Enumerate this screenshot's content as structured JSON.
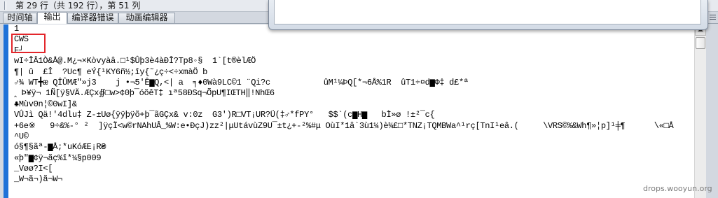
{
  "status_bar": {
    "position": "第 29 行（共 192 行），第 51 列"
  },
  "tabs": [
    {
      "label": "时间轴",
      "active": false
    },
    {
      "label": "输出",
      "active": true
    },
    {
      "label": "编译器错误",
      "active": false
    },
    {
      "label": "动画编辑器",
      "active": false
    }
  ],
  "output": {
    "lines": [
      "1",
      "CWS",
      "F┘",
      "wI÷ÎÂ1Ò&Å@.M¿¬×Kòvyàâ.□¹$Ûþ3è4àÐÎ?Tp8◦§  1`[t®èlÆÖ",
      "¶| û  £Î  ?Uc¶ eÝ{¹KY6ñ½;îy{˜¿ç÷<÷xmàÖ b",
      "♂¾ WT╋æ QÎÛMÆ\"»j3    j •¬5'Ê▆Q,<| a  ╕♦0Wà9LC©1 ¨Qi?c           ûM¹¼ÞQ[*¬6Å%1R  ûT1÷¤d▆Φ‡ d£*ª",
      "‸ Þ¥ÿ¬ 1Ñ[ÿ§VÄ.ÆÇx∯□w>¢0þ¯óõêT‡ ıª58ÐSq¬ÕpU¶IŒTH‖!NhŒ6",
      "♣Mùv0n¦©0wI]&",
      "VÛJì Qä!'4dlu‡ Z-±Uø{ÿÿþÿõ+þ¯ãGÇx& v:0z  G3')R□VT¡UR?Ü(‡♂*fPY°   $$`(c▆H▆   bÌ»ø !±²¯c{",
      "+6e※   9÷&%-° ²  ]ÿçÏ<w©rNAhUÂ_%W:e•ÐçJ)zz²|μUtávùZ9U¯±t¿+-²%#μ OùI*1â`3ù1¼)è¾£□*TNZ¡TQMBWa^¹rç[TnI¹eâ.(     \\VRS©%&Wh¶»¦p]¹╪¶      \\«□Å",
      "^U©",
      "ó§¶§ãª-▆Å;*uKóÆE¡R₴",
      "«þ\"▆¢ÿ¬ãç%î*¼§p009",
      "_Vøø?I<[",
      "_W¬ã¬)ã¬W¬"
    ]
  },
  "annotation": {
    "highlight_color": "#e3262b"
  },
  "theme": {
    "selection_bar": "#1f72d8"
  },
  "icons": {
    "panel_menu": "panel-menu-icon",
    "scroll_up": "scroll-up-arrow-icon"
  },
  "watermark": {
    "text": "drops.wooyun.org"
  }
}
